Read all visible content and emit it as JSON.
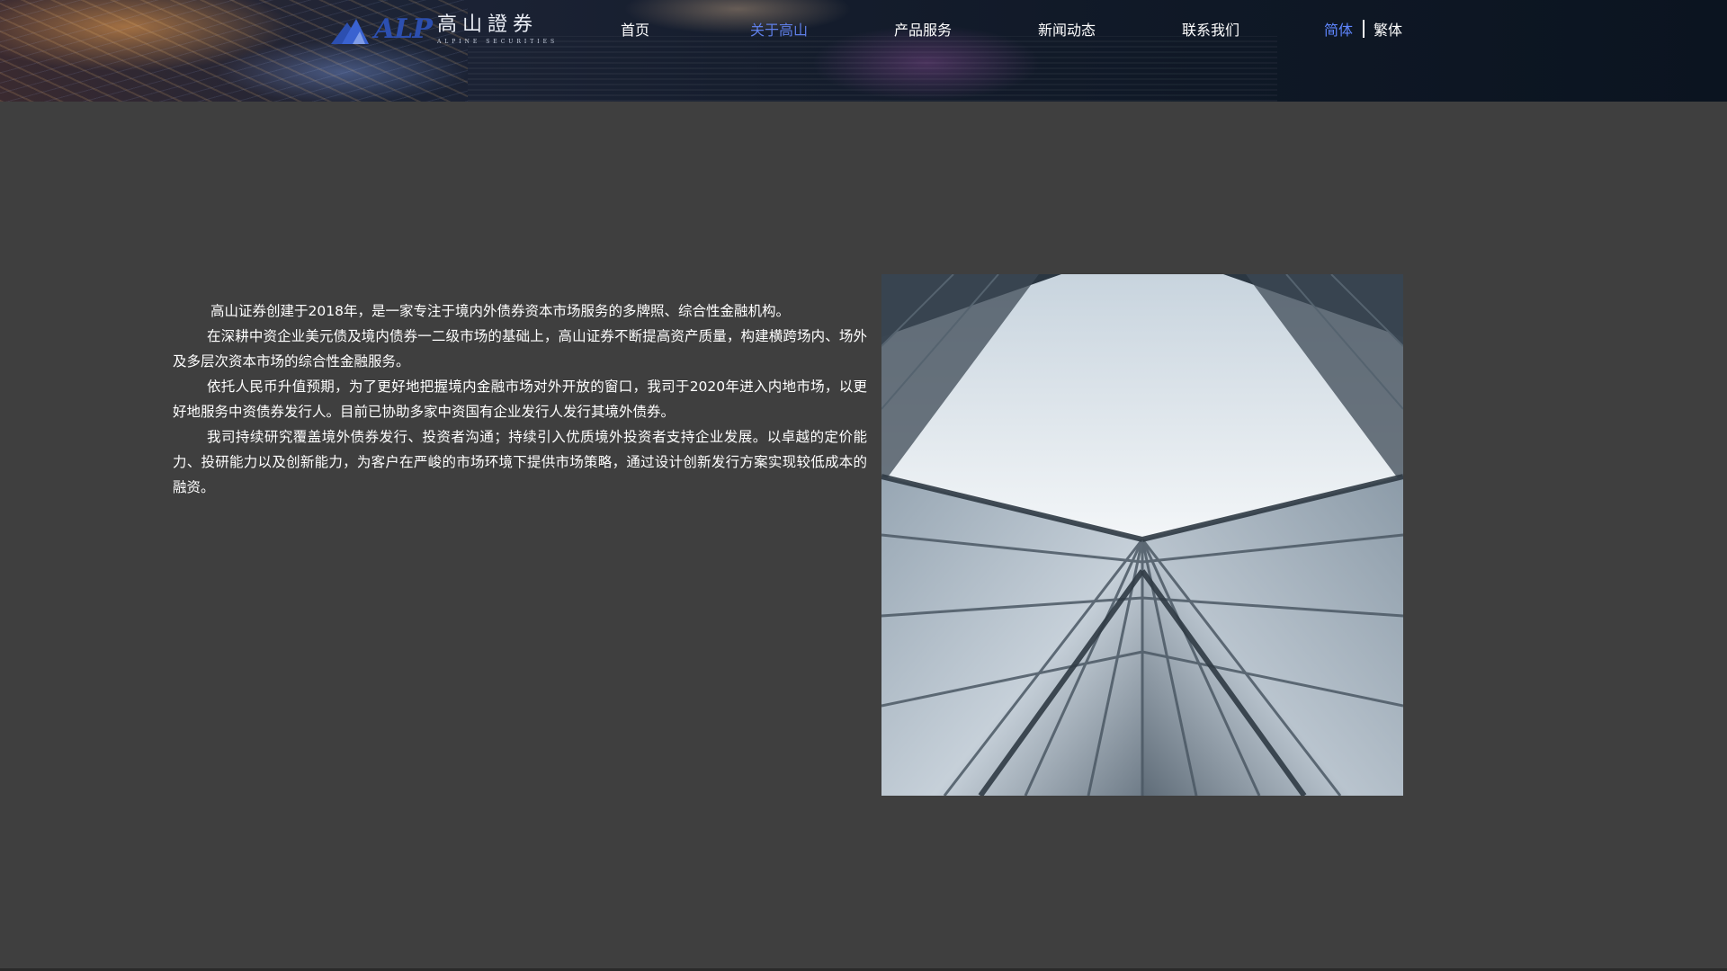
{
  "header": {
    "logo": {
      "mark_icon": "mountain-peaks-logo-icon",
      "letters": "ALP",
      "name_cn": "高山證券",
      "name_en": "ALPINE SECURITIES"
    },
    "nav": [
      {
        "label": "首页",
        "active": false
      },
      {
        "label": "关于高山",
        "active": true
      },
      {
        "label": "产品服务",
        "active": false
      },
      {
        "label": "新闻动态",
        "active": false
      },
      {
        "label": "联系我们",
        "active": false
      }
    ],
    "language": {
      "simplified": "简体",
      "traditional": "繁体",
      "active": "simplified"
    }
  },
  "about": {
    "paragraphs": [
      "高山证券创建于2018年，是一家专注于境内外债券资本市场服务的多牌照、综合性金融机构。",
      "在深耕中资企业美元债及境内债券一二级市场的基础上，高山证券不断提高资产质量，构建横跨场内、场外及多层次资本市场的综合性金融服务。",
      "依托人民币升值预期，为了更好地把握境内金融市场对外开放的窗口，我司于2020年进入内地市场，以更好地服务中资债券发行人。目前已协助多家中资国有企业发行人发行其境外债券。",
      "我司持续研究覆盖境外债券发行、投资者沟通；持续引入优质境外投资者支持企业发展。以卓越的定价能力、投研能力以及创新能力，为客户在严峻的市场环境下提供市场策略，通过设计创新发行方案实现较低成本的融资。"
    ],
    "image": "skyscraper-glass-facade-upward-view"
  },
  "colors": {
    "page_background": "#3f3f3f",
    "accent": "#5f86ff",
    "text": "#ffffff",
    "logo_blue": "#2c4fb0"
  }
}
